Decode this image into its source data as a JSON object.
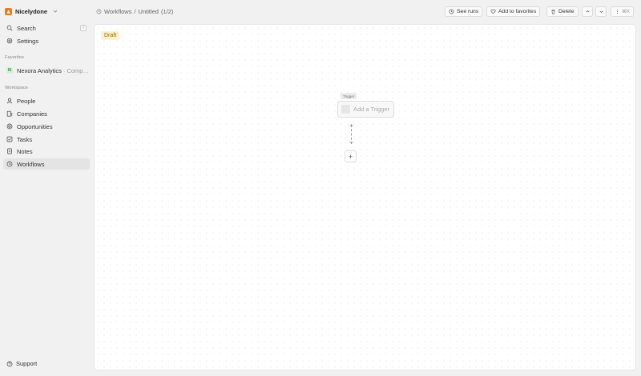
{
  "workspace": {
    "name": "Nicelydone",
    "accent": "#f07a1a"
  },
  "sidebar": {
    "search_label": "Search",
    "search_shortcut": "/",
    "settings_label": "Settings",
    "favorites_title": "Favorites",
    "favorites": [
      {
        "initial": "N",
        "name": "Nexora Analytics",
        "sub": "· Compa..."
      }
    ],
    "workspace_title": "Workspace",
    "items": [
      {
        "label": "People",
        "icon": "user-icon"
      },
      {
        "label": "Companies",
        "icon": "building-icon"
      },
      {
        "label": "Opportunities",
        "icon": "target-icon"
      },
      {
        "label": "Tasks",
        "icon": "checkbox-icon"
      },
      {
        "label": "Notes",
        "icon": "note-icon"
      },
      {
        "label": "Workflows",
        "icon": "workflow-icon",
        "active": true
      }
    ],
    "support_label": "Support"
  },
  "header": {
    "breadcrumb_parent": "Workflows",
    "breadcrumb_sep": "/",
    "breadcrumb_current": "Untitled",
    "breadcrumb_count": "(1/2)",
    "see_runs": "See runs",
    "add_favorites": "Add to favorites",
    "delete": "Delete",
    "shortcut": "⌘K"
  },
  "canvas": {
    "status": "Draft",
    "trigger_tag": "Trigger",
    "trigger_placeholder": "Add a Trigger",
    "add_step": "+"
  }
}
